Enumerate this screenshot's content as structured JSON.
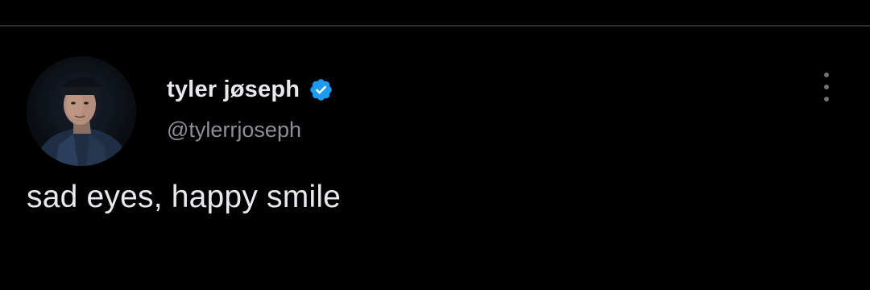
{
  "tweet": {
    "author": {
      "display_name": "tyler jøseph",
      "handle": "@tylerrjoseph",
      "verified": true,
      "verified_icon": "verified-badge-icon",
      "avatar": "profile-photo"
    },
    "text": "sad eyes, happy smile",
    "more_icon": "more-vertical-icon"
  },
  "colors": {
    "background": "#000000",
    "text_primary": "#e7e9ea",
    "text_secondary": "#8b9096",
    "verified_blue": "#1d9bf0",
    "divider": "#2a2d30"
  }
}
